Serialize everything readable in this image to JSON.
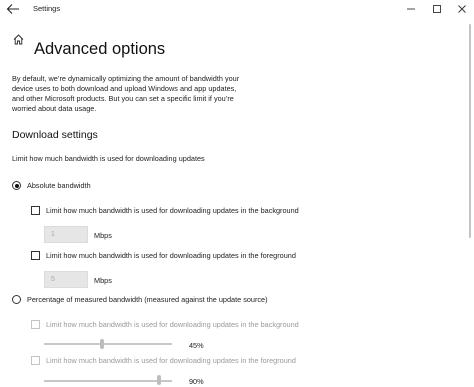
{
  "window": {
    "title": "Settings",
    "controls": {
      "minimize": "—",
      "maximize": "☐",
      "close": "✕"
    }
  },
  "page": {
    "title": "Advanced options",
    "description": "By default, we’re dynamically optimizing the amount of bandwidth your device uses to both download and upload Windows and app updates, and other Microsoft products. But you can set a specific limit if you’re worried about data usage."
  },
  "download": {
    "heading": "Download settings",
    "subtitle": "Limit how much bandwidth is used for downloading updates",
    "absolute": {
      "label": "Absolute bandwidth",
      "selected": true,
      "background": {
        "label": "Limit how much bandwidth is used for downloading updates in the background",
        "checked": false,
        "value": "1",
        "unit": "Mbps"
      },
      "foreground": {
        "label": "Limit how much bandwidth is used for downloading updates in the foreground",
        "checked": false,
        "value": "5",
        "unit": "Mbps"
      }
    },
    "percentage": {
      "label": "Percentage of measured bandwidth (measured against the update source)",
      "selected": false,
      "background": {
        "label": "Limit how much bandwidth is used for downloading updates in the background",
        "checked": false,
        "value_label": "45%",
        "value": 45
      },
      "foreground": {
        "label": "Limit how much bandwidth is used for downloading updates in the foreground",
        "checked": false,
        "value_label": "90%",
        "value": 90
      }
    }
  }
}
